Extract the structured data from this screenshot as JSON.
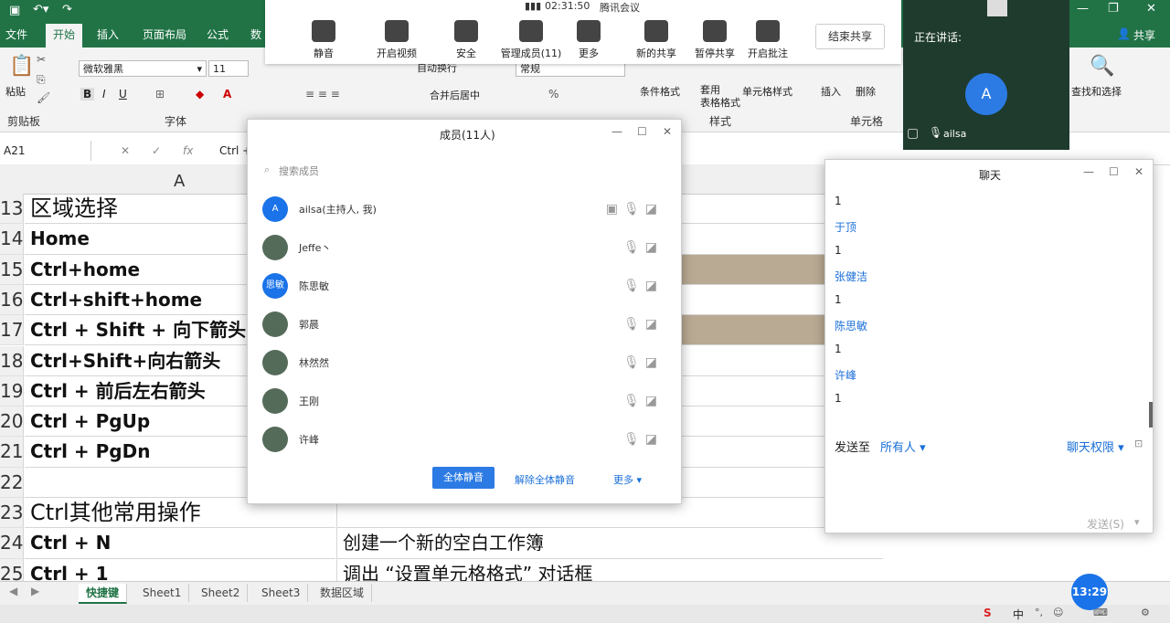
{
  "excel": {
    "tabs": [
      "文件",
      "开始",
      "插入",
      "页面布局",
      "公式",
      "数"
    ],
    "active_tab": "开始",
    "font_name": "微软雅黑",
    "font_size": "11",
    "number_format": "常规",
    "ribbon_items": {
      "paste": "粘贴",
      "clipboard": "剪贴板",
      "font": "字体",
      "wrap_text": "自动换行",
      "merge_center": "合并后居中",
      "conditional_format": "条件格式",
      "table_format": "套用\n表格格式",
      "cell_style": "单元格样式",
      "styles": "样式",
      "insert": "插入",
      "delete": "删除",
      "cells": "单元格",
      "find_select": "查找和选择"
    },
    "name_box": "A21",
    "formula_text": "Ctrl +",
    "col_header": "A",
    "rows": [
      {
        "num": "13",
        "a": "区域选择",
        "b": "",
        "big": true
      },
      {
        "num": "14",
        "a": "Home",
        "b": ""
      },
      {
        "num": "15",
        "a": "Ctrl+home",
        "b": "",
        "shaded": true
      },
      {
        "num": "16",
        "a": "Ctrl+shift+home",
        "b": "的开头"
      },
      {
        "num": "17",
        "a": "Ctrl + Shift + 向下箭头",
        "b": "",
        "shaded": true
      },
      {
        "num": "18",
        "a": "Ctrl+Shift+向右箭头",
        "b": ""
      },
      {
        "num": "19",
        "a": "Ctrl + 前后左右箭头",
        "b": ""
      },
      {
        "num": "20",
        "a": "Ctrl + PgUp",
        "b": "表"
      },
      {
        "num": "21",
        "a": "Ctrl + PgDn",
        "b": ""
      },
      {
        "num": "22",
        "a": "",
        "b": ""
      },
      {
        "num": "23",
        "a": "Ctrl其他常用操作",
        "b": "",
        "big": true
      },
      {
        "num": "24",
        "a": "Ctrl + N",
        "b": "创建一个新的空白工作簿"
      },
      {
        "num": "25",
        "a": "Ctrl + 1",
        "b": "调出 “设置单元格格式” 对话框"
      }
    ],
    "sheet_tabs": [
      "快捷键",
      "Sheet1",
      "Sheet2",
      "Sheet3",
      "数据区域"
    ],
    "active_sheet": "快捷键"
  },
  "meeting": {
    "time": "02:31:50",
    "app_name": "腾讯会议",
    "toolbar": [
      {
        "label": "静音",
        "icon": "microphone-icon"
      },
      {
        "label": "开启视频",
        "icon": "camera-off-icon"
      },
      {
        "label": "安全",
        "icon": "shield-icon"
      },
      {
        "label": "管理成员(11)",
        "icon": "members-icon"
      },
      {
        "label": "更多",
        "icon": "more-icon"
      },
      {
        "label": "新的共享",
        "icon": "screen-share-icon"
      },
      {
        "label": "暂停共享",
        "icon": "pause-icon"
      },
      {
        "label": "开启批注",
        "icon": "annotate-icon"
      }
    ],
    "end_share": "结束共享",
    "share_label": "共享",
    "speaking": {
      "title": "正在讲话:",
      "avatar_letter": "A",
      "speaker_name": "ailsa"
    }
  },
  "members_dialog": {
    "title": "成员(11人)",
    "search_placeholder": "搜索成员",
    "members": [
      {
        "avatar": "A",
        "name": "ailsa(主持人, 我)"
      },
      {
        "avatar": "",
        "name": "Jeffe丶"
      },
      {
        "avatar": "思敏",
        "name": "陈思敏"
      },
      {
        "avatar": "",
        "name": "郭晨"
      },
      {
        "avatar": "",
        "name": "林然然"
      },
      {
        "avatar": "",
        "name": "王刚"
      },
      {
        "avatar": "",
        "name": "许峰"
      }
    ],
    "mute_all": "全体静音",
    "unmute_all": "解除全体静音",
    "more": "更多"
  },
  "chat": {
    "title": "聊天",
    "messages": [
      {
        "type": "msg",
        "text": "1"
      },
      {
        "type": "name",
        "text": "于顶"
      },
      {
        "type": "msg",
        "text": "1"
      },
      {
        "type": "name",
        "text": "张健洁"
      },
      {
        "type": "msg",
        "text": "1"
      },
      {
        "type": "name",
        "text": "陈思敏"
      },
      {
        "type": "msg",
        "text": "1"
      },
      {
        "type": "name",
        "text": "许峰"
      },
      {
        "type": "msg",
        "text": "1"
      }
    ],
    "send_to_label": "发送至",
    "send_to_value": "所有人",
    "permission": "聊天权限",
    "send_button": "发送(S)"
  },
  "tray": {
    "timer": "13:29",
    "ime": "中"
  }
}
